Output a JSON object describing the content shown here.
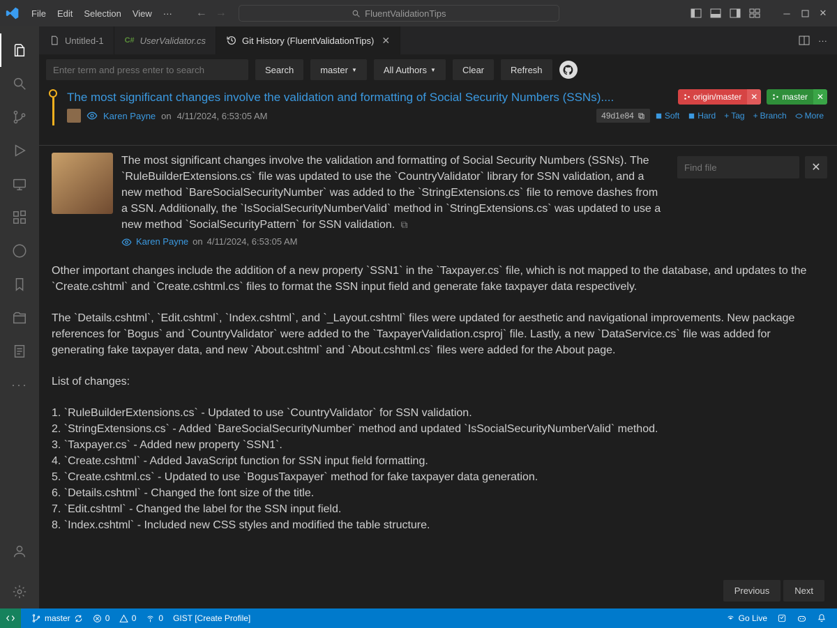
{
  "title": "FluentValidationTips",
  "menu": {
    "file": "File",
    "edit": "Edit",
    "selection": "Selection",
    "view": "View"
  },
  "tabs": {
    "untitled": "Untitled-1",
    "userval": "UserValidator.cs",
    "githist": "Git History (FluentValidationTips)"
  },
  "toolbar": {
    "search_placeholder": "Enter term and press enter to search",
    "search": "Search",
    "branch": "master",
    "authors": "All Authors",
    "clear": "Clear",
    "refresh": "Refresh"
  },
  "commit": {
    "subject": "The most significant changes involve the validation and formatting of Social Security Numbers (SSNs)....",
    "author": "Karen Payne",
    "date": "4/11/2024, 6:53:05 AM",
    "on": "on",
    "hash": "49d1e84",
    "refs": {
      "origin": "origin/master",
      "local": "master"
    },
    "actions": {
      "soft": "Soft",
      "hard": "Hard",
      "tag": "Tag",
      "branch": "Branch",
      "more": "More"
    }
  },
  "find_placeholder": "Find file",
  "detail": {
    "message": "The most significant changes involve the validation and formatting of Social Security Numbers (SSNs). The `RuleBuilderExtensions.cs` file was updated to use the `CountryValidator` library for SSN validation, and a new method `BareSocialSecurityNumber` was added to the `StringExtensions.cs` file to remove dashes from a SSN. Additionally, the `IsSocialSecurityNumberValid` method in `StringExtensions.cs` was updated to use a new method `SocialSecurityPattern` for SSN validation.",
    "para1": "Other important changes include the addition of a new property `SSN1` in the `Taxpayer.cs` file, which is not mapped to the database, and updates to the `Create.cshtml` and `Create.cshtml.cs` files to format the SSN input field and generate fake taxpayer data respectively.",
    "para2": "The `Details.cshtml`, `Edit.cshtml`, `Index.cshtml`, and `_Layout.cshtml` files were updated for aesthetic and navigational improvements. New package references for `Bogus` and `CountryValidator` were added to the `TaxpayerValidation.csproj` file. Lastly, a new `DataService.cs` file was added for generating fake taxpayer data, and new `About.cshtml` and `About.cshtml.cs` files were added for the About page.",
    "list_header": "List of changes:",
    "items": [
      "1. `RuleBuilderExtensions.cs` - Updated to use `CountryValidator` for SSN validation.",
      "2. `StringExtensions.cs` - Added `BareSocialSecurityNumber` method and updated `IsSocialSecurityNumberValid` method.",
      "3. `Taxpayer.cs` - Added new property `SSN1`.",
      "4. `Create.cshtml` - Added JavaScript function for SSN input field formatting.",
      "5. `Create.cshtml.cs` - Updated to use `BogusTaxpayer` method for fake taxpayer data generation.",
      "6. `Details.cshtml` - Changed the font size of the title.",
      "7. `Edit.cshtml` - Changed the label for the SSN input field.",
      "8. `Index.cshtml` - Included new CSS styles and modified the table structure."
    ]
  },
  "pager": {
    "prev": "Previous",
    "next": "Next"
  },
  "status": {
    "branch": "master",
    "errors": "0",
    "warnings": "0",
    "ports": "0",
    "gist": "GIST [Create Profile]",
    "golive": "Go Live"
  }
}
